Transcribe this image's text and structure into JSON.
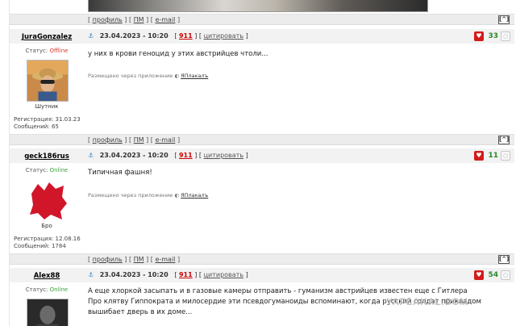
{
  "footer": {
    "open_bracket": "[",
    "profile": "профиль",
    "sep": "|",
    "pm": "ПМ",
    "email": "e-mail",
    "close_bracket": "]",
    "up": "[^]"
  },
  "posts": [
    {
      "username": "JuraGonzalez",
      "status_label": "Статус:",
      "status_value": "Offline",
      "avatar_caption": "Шутник",
      "reg_label": "Регистрация:",
      "reg_date": "31.03.23",
      "msgs_label": "Сообщений:",
      "msgs": "65",
      "date": "23.04.2023 - 10:20",
      "number": "911",
      "cite": "цитировать",
      "rating": "33",
      "text_lines": [
        "у них в крови геноцид у этих австрийцев чтоли..."
      ],
      "via_label": "Размещено через приложение",
      "via_app": "ЯПлакалъ"
    },
    {
      "username": "geck186rus",
      "status_label": "Статус:",
      "status_value": "Online",
      "avatar_caption": "Бро",
      "reg_label": "Регистрация:",
      "reg_date": "12.08.16",
      "msgs_label": "Сообщений:",
      "msgs": "1784",
      "date": "23.04.2023 - 10:20",
      "number": "911",
      "cite": "цитировать",
      "rating": "11",
      "text_lines": [
        "Типичная фашня!"
      ],
      "via_label": "Размещено через приложение",
      "via_app": "ЯПлакалъ"
    },
    {
      "username": "Alex88",
      "status_label": "Статус:",
      "status_value": "Online",
      "date": "23.04.2023 - 10:20",
      "number": "911",
      "cite": "цитировать",
      "rating": "54",
      "text_lines": [
        "А еще хлоркой засыпать и в газовые камеры отправить - гуманизм австрийцев известен еще с Гитлера",
        "Про клятву Гиппократа и милосердие эти псевдогуманоиды вспоминают, когда русский солдат прикладом",
        "вышибает дверь в их доме..."
      ]
    }
  ],
  "watermark": "YAPLAKAL.COM",
  "colors": {
    "offline": "#d23b2e",
    "online": "#3aa33a",
    "rating": "#2a8a2a",
    "post_number": "#cc0000"
  }
}
